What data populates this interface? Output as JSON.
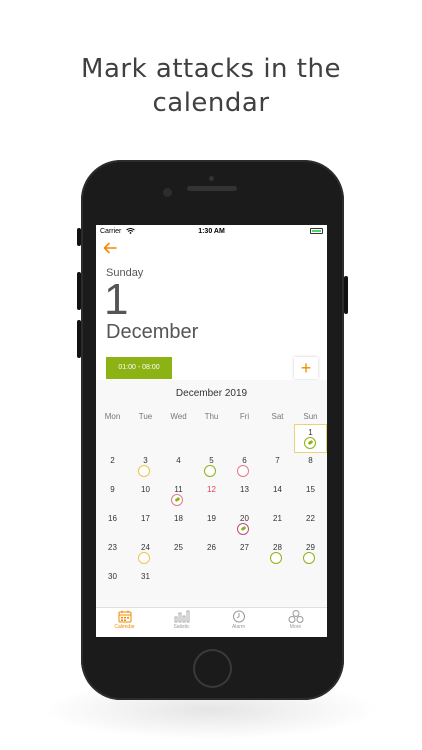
{
  "headline": {
    "line1": "Mark attacks in the",
    "line2": "calendar"
  },
  "status_bar": {
    "carrier": "Carrier",
    "time": "1:30 AM"
  },
  "selected_date": {
    "weekday": "Sunday",
    "day": "1",
    "month": "December"
  },
  "time_range": "01:00 - 08:00",
  "add_label": "+",
  "calendar": {
    "title": "December 2019",
    "weekdays": [
      "Mon",
      "Tue",
      "Wed",
      "Thu",
      "Fri",
      "Sat",
      "Sun"
    ],
    "days": [
      {
        "n": "1",
        "ring": "pill",
        "ring_color": "#8cb214",
        "selected": true
      },
      {
        "n": "2"
      },
      {
        "n": "3",
        "ring": "plain",
        "ring_color": "#f2c24b"
      },
      {
        "n": "4"
      },
      {
        "n": "5",
        "ring": "plain",
        "ring_color": "#8cb214"
      },
      {
        "n": "6",
        "ring": "plain",
        "ring_color": "#e07a8a"
      },
      {
        "n": "7"
      },
      {
        "n": "8"
      },
      {
        "n": "9"
      },
      {
        "n": "10"
      },
      {
        "n": "11",
        "ring": "pill",
        "ring_color": "#e07a8a"
      },
      {
        "n": "12",
        "red": true
      },
      {
        "n": "13"
      },
      {
        "n": "14"
      },
      {
        "n": "15"
      },
      {
        "n": "16"
      },
      {
        "n": "17"
      },
      {
        "n": "18"
      },
      {
        "n": "19"
      },
      {
        "n": "20",
        "ring": "pill",
        "ring_color": "#c0488a"
      },
      {
        "n": "21"
      },
      {
        "n": "22"
      },
      {
        "n": "23"
      },
      {
        "n": "24",
        "ring": "plain",
        "ring_color": "#f2c24b"
      },
      {
        "n": "25"
      },
      {
        "n": "26"
      },
      {
        "n": "27"
      },
      {
        "n": "28",
        "ring": "plain",
        "ring_color": "#8cb214"
      },
      {
        "n": "29",
        "ring": "plain",
        "ring_color": "#8cb214"
      },
      {
        "n": "30"
      },
      {
        "n": "31"
      }
    ]
  },
  "tabs": [
    {
      "label": "Calendar",
      "icon": "calendar-icon",
      "active": true
    },
    {
      "label": "Satistic",
      "icon": "bar-chart-icon",
      "active": false
    },
    {
      "label": "Alarm",
      "icon": "clock-icon",
      "active": false
    },
    {
      "label": "More",
      "icon": "more-icon",
      "active": false
    }
  ],
  "colors": {
    "accent": "#f08a00",
    "green": "#8cb214"
  }
}
